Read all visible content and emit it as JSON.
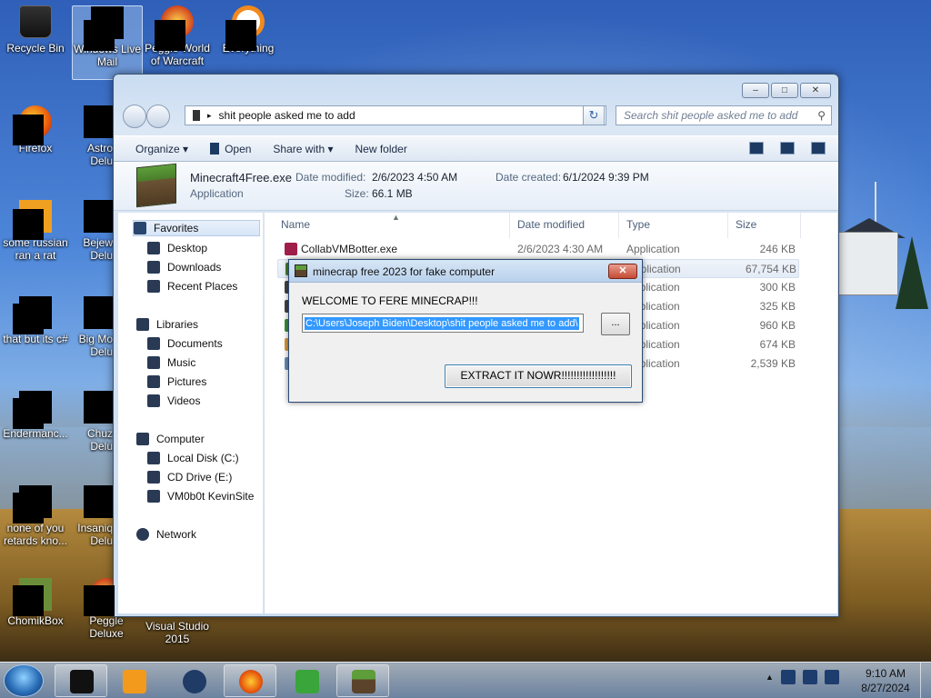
{
  "desktop": {
    "icons": [
      {
        "label": "Recycle Bin"
      },
      {
        "label": "Windows Live Mail"
      },
      {
        "label": "Peggle World of Warcraft"
      },
      {
        "label": "Everything"
      },
      {
        "label": "Firefox"
      },
      {
        "label": "Astro Delu"
      },
      {
        "label": "some russian ran a rat"
      },
      {
        "label": "Bejew Delu"
      },
      {
        "label": "that but its c#"
      },
      {
        "label": "Big Mo Delu"
      },
      {
        "label": "Endermanc..."
      },
      {
        "label": "Chuz Delu"
      },
      {
        "label": "none of you retards kno..."
      },
      {
        "label": "Insaniq Delu"
      },
      {
        "label": "ChomikBox"
      },
      {
        "label": "Peggle Deluxe"
      },
      {
        "label": "Visual Studio 2015"
      }
    ]
  },
  "explorer": {
    "window_buttons": {
      "minimize": "–",
      "maximize": "□",
      "close": "✕"
    },
    "address": "shit people asked me to add",
    "search_placeholder": "Search shit people asked me to add",
    "toolbar": {
      "organize": "Organize ▾",
      "open": "Open",
      "share_with": "Share with ▾",
      "new_folder": "New folder"
    },
    "details": {
      "filename": "Minecraft4Free.exe",
      "filetype": "Application",
      "modified_label": "Date modified:",
      "modified_value": "2/6/2023 4:50 AM",
      "size_label": "Size:",
      "size_value": "66.1 MB",
      "created_label": "Date created:",
      "created_value": "6/1/2024 9:39 PM"
    },
    "nav": {
      "favorites": "Favorites",
      "desktop": "Desktop",
      "downloads": "Downloads",
      "recent": "Recent Places",
      "libraries": "Libraries",
      "documents": "Documents",
      "music": "Music",
      "pictures": "Pictures",
      "videos": "Videos",
      "computer": "Computer",
      "local_disk": "Local Disk (C:)",
      "cd_drive": "CD Drive (E:)",
      "vm": "VM0b0t KevinSite",
      "network": "Network"
    },
    "columns": {
      "name": "Name",
      "date": "Date modified",
      "type": "Type",
      "size": "Size"
    },
    "files": [
      {
        "name": "CollabVMBotter.exe",
        "date": "2/6/2023 4:30 AM",
        "type": "Application",
        "size": "246 KB"
      },
      {
        "name": "",
        "date": "",
        "type": "Application",
        "size": "67,754 KB"
      },
      {
        "name": "",
        "date": "",
        "type": "Application",
        "size": "300 KB"
      },
      {
        "name": "",
        "date": "",
        "type": "Application",
        "size": "325 KB"
      },
      {
        "name": "",
        "date": "",
        "type": "Application",
        "size": "960 KB"
      },
      {
        "name": "",
        "date": "",
        "type": "Application",
        "size": "674 KB"
      },
      {
        "name": "",
        "date": "",
        "type": "Application",
        "size": "2,539 KB"
      }
    ]
  },
  "dialog": {
    "title": "minecrap free 2023 for fake computer",
    "close": "✕",
    "message": "WELCOME TO FERE MINECRAP!!!",
    "path": "C:\\Users\\Joseph Biden\\Desktop\\shit people asked me to add\\",
    "browse": "...",
    "extract": "EXTRACT IT NOWR!!!!!!!!!!!!!!!!!!"
  },
  "taskbar": {
    "time": "9:10 AM",
    "date": "8/27/2024"
  }
}
